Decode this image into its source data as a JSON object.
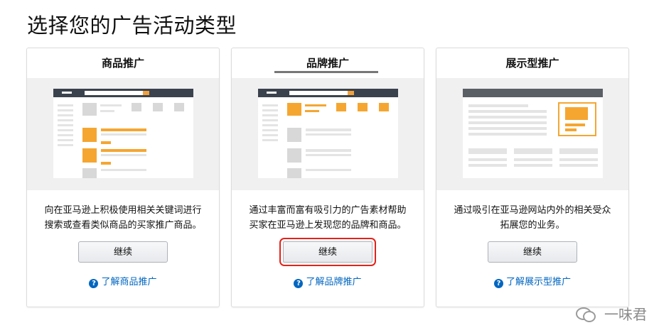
{
  "page": {
    "title": "选择您的广告活动类型"
  },
  "cards": [
    {
      "title": "商品推广",
      "description_line1": "向在亚马逊上积极使用相关关键词进行",
      "description_line2": "搜索或查看类似商品的买家推广商品。",
      "button_label": "继续",
      "learn_link": "了解商品推广"
    },
    {
      "title": "品牌推广",
      "description_line1": "通过丰富而富有吸引力的广告素材帮助",
      "description_line2": "买家在亚马逊上发现您的品牌和商品。",
      "button_label": "继续",
      "learn_link": "了解品牌推广"
    },
    {
      "title": "展示型推广",
      "description_line1": "通过吸引在亚马逊网站内外的相关受众",
      "description_line2": "拓展您的业务。",
      "button_label": "继续",
      "learn_link": "了解展示型推广"
    }
  ],
  "help_icon": "?",
  "watermark": {
    "text": "一味君"
  },
  "colors": {
    "accent": "#f5a631",
    "link": "#0066c0",
    "highlight": "#e2231a"
  }
}
